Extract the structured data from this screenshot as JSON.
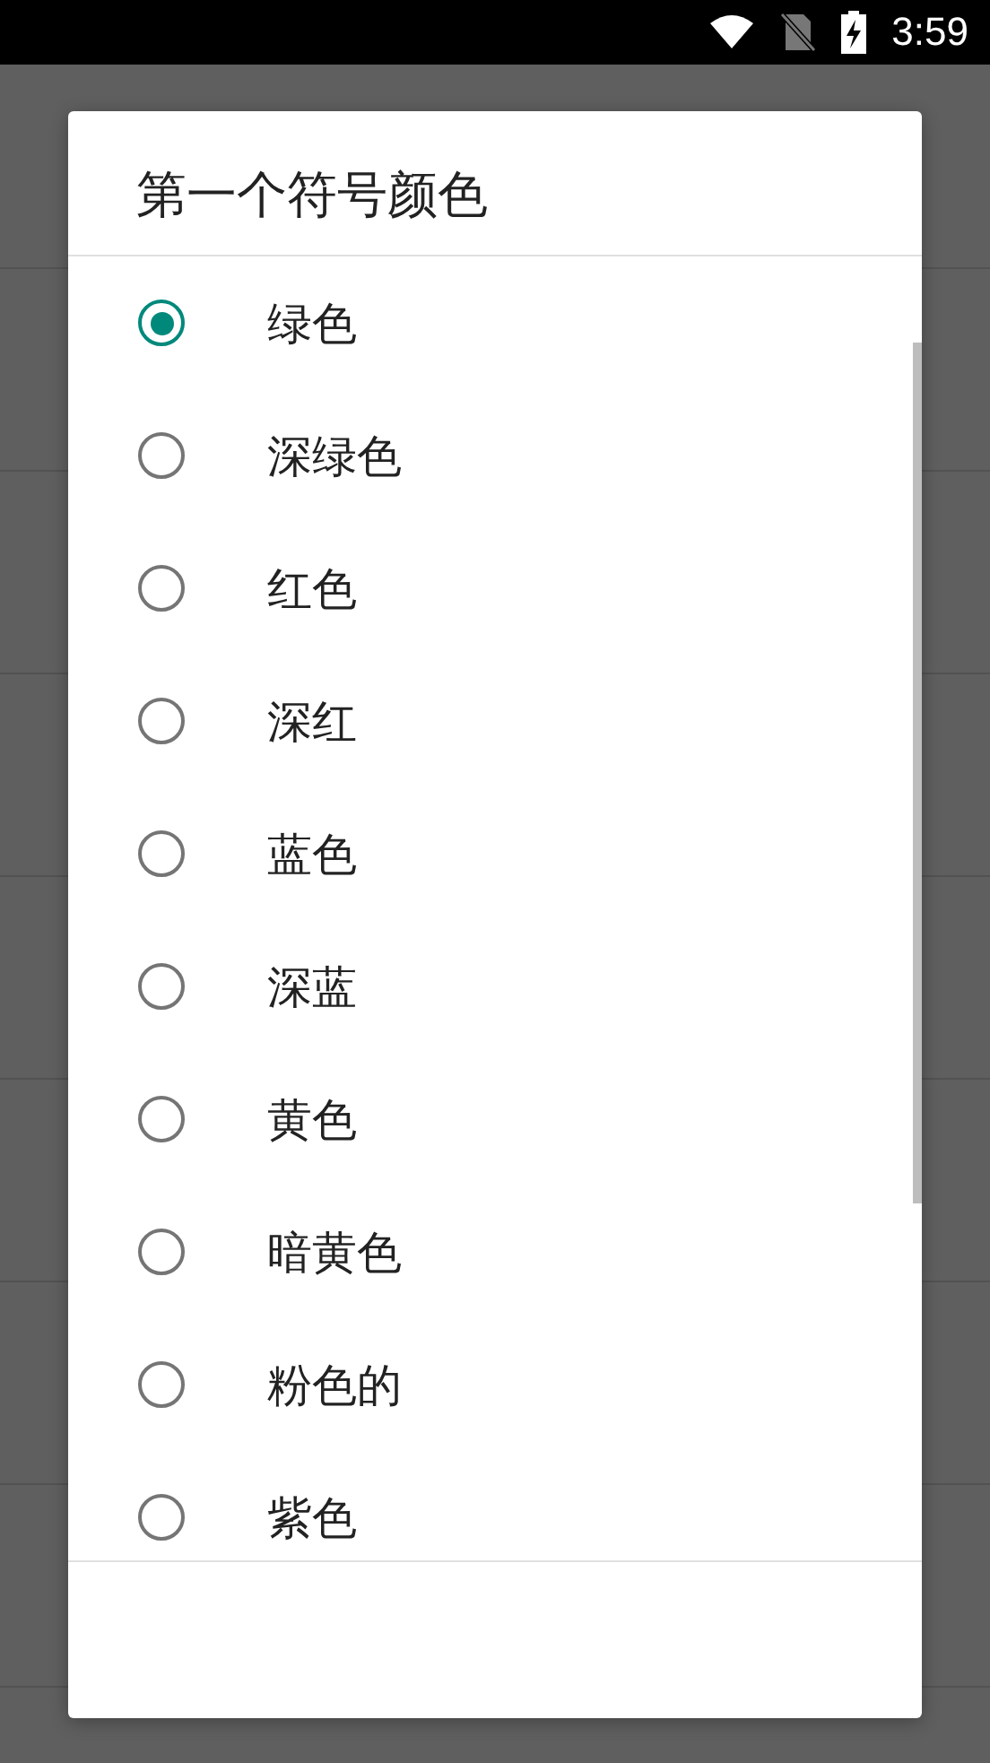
{
  "status_bar": {
    "time": "3:59"
  },
  "dialog": {
    "title": "第一个符号颜色",
    "options": [
      {
        "label": "绿色",
        "selected": true
      },
      {
        "label": "深绿色",
        "selected": false
      },
      {
        "label": "红色",
        "selected": false
      },
      {
        "label": "深红",
        "selected": false
      },
      {
        "label": "蓝色",
        "selected": false
      },
      {
        "label": "深蓝",
        "selected": false
      },
      {
        "label": "黄色",
        "selected": false
      },
      {
        "label": "暗黄色",
        "selected": false
      },
      {
        "label": "粉色的",
        "selected": false
      },
      {
        "label": "紫色",
        "selected": false
      }
    ]
  }
}
